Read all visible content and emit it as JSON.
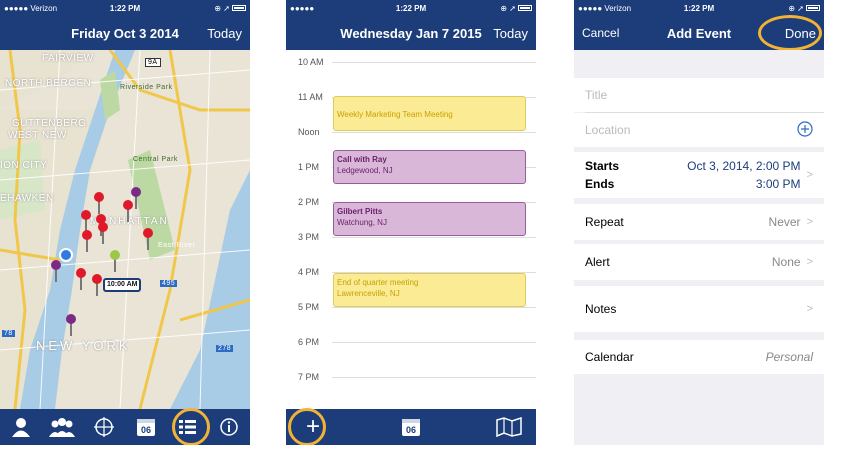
{
  "status": {
    "carrier": "●●●●● Verizon",
    "time": "1:22 PM",
    "right": "⊕ ➚"
  },
  "status2": {
    "carrier": "●●●●●",
    "time": "1:22 PM",
    "right": "⊕ ➚"
  },
  "map_screen": {
    "title": "Friday Oct 3 2014",
    "today": "Today",
    "labels": [
      "FAIRVIEW",
      "NORTH BERGEN",
      "GUTTENBERG",
      "WEST NEW",
      "ION CITY",
      "EHAWKEN",
      "Riverside Park",
      "Central Park",
      "MANHATTAN",
      "NEW YORK",
      "East River"
    ],
    "highway_labels": [
      "9A",
      "495",
      "278",
      "78"
    ],
    "badge": "10:00 AM",
    "tab_calendar_day": "06"
  },
  "calendar_screen": {
    "title": "Wednesday Jan 7 2015",
    "today": "Today",
    "hours": [
      "10 AM",
      "11 AM",
      "Noon",
      "1 PM",
      "2 PM",
      "3 PM",
      "4 PM",
      "5 PM",
      "6 PM",
      "7 PM"
    ],
    "events": [
      {
        "title": "Weekly Marketing Team Meeting",
        "loc": ""
      },
      {
        "title": "Call with Ray",
        "loc": "Ledgewood, NJ"
      },
      {
        "title": "Gilbert Pitts",
        "loc": "Watchung, NJ"
      },
      {
        "title": "End of quarter meeting",
        "loc": "Lawrenceville, NJ"
      }
    ],
    "tab_calendar_day": "06",
    "add": "+"
  },
  "add_event_screen": {
    "cancel": "Cancel",
    "title": "Add Event",
    "done": "Done",
    "title_placeholder": "Title",
    "location_placeholder": "Location",
    "starts_label": "Starts",
    "ends_label": "Ends",
    "starts_value": "Oct 3, 2014, 2:00 PM",
    "ends_value": "3:00 PM",
    "repeat_label": "Repeat",
    "repeat_value": "Never",
    "alert_label": "Alert",
    "alert_value": "None",
    "notes_label": "Notes",
    "calendar_label": "Calendar",
    "calendar_value": "Personal"
  },
  "colors": {
    "nav": "#1c3d7a",
    "highlight": "#f2b233",
    "pin_red": "#e0192a",
    "pin_purple": "#7b2a86"
  }
}
